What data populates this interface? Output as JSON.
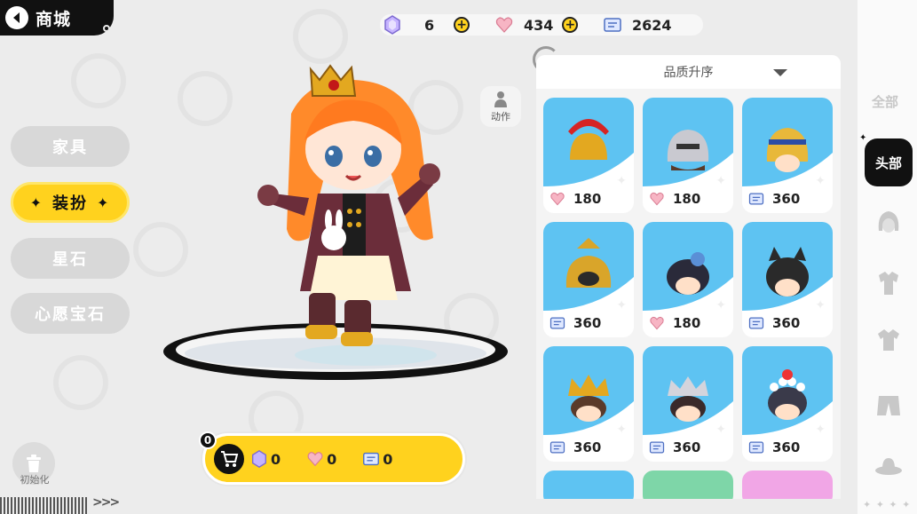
{
  "header": {
    "title": "商城"
  },
  "currencies": [
    {
      "name": "star-gem",
      "value": "6",
      "color": "#b9a4ff"
    },
    {
      "name": "heart-gem",
      "value": "434",
      "color": "#f4a6b8"
    },
    {
      "name": "ticket",
      "value": "2624",
      "color": "#6b8fd6"
    }
  ],
  "categories": [
    {
      "label": "家具",
      "active": false
    },
    {
      "label": "装扮",
      "active": true
    },
    {
      "label": "星石",
      "active": false
    },
    {
      "label": "心愿宝石",
      "active": false
    }
  ],
  "action": {
    "label": "动作"
  },
  "reset": {
    "label": "初始化"
  },
  "cart": {
    "count": "0",
    "items": [
      {
        "name": "star-gem",
        "value": "0"
      },
      {
        "name": "heart-gem",
        "value": "0"
      },
      {
        "name": "ticket",
        "value": "0"
      }
    ]
  },
  "panel": {
    "sort_label": "品质升序",
    "items": [
      {
        "name": "roman-helmet",
        "currency": "heart-gem",
        "price": "180"
      },
      {
        "name": "knight-helmet",
        "currency": "heart-gem",
        "price": "180"
      },
      {
        "name": "pharaoh-headdress",
        "currency": "ticket",
        "price": "360"
      },
      {
        "name": "gold-armor-helmet",
        "currency": "ticket",
        "price": "360"
      },
      {
        "name": "cap-hair",
        "currency": "heart-gem",
        "price": "180"
      },
      {
        "name": "cat-ear-hair",
        "currency": "ticket",
        "price": "360"
      },
      {
        "name": "golden-crown-hair",
        "currency": "ticket",
        "price": "360"
      },
      {
        "name": "silver-crown-hair",
        "currency": "ticket",
        "price": "360"
      },
      {
        "name": "pearl-headband",
        "currency": "ticket",
        "price": "360"
      }
    ]
  },
  "right_rail": {
    "all_label": "全部",
    "active_label": "头部",
    "icons": [
      "hair-icon",
      "outfit-icon",
      "shirt-icon",
      "pants-icon",
      "hat-icon"
    ]
  },
  "colors": {
    "accent": "#ffd21e",
    "card_blue": "#5ec3f2",
    "dark": "#111111"
  }
}
